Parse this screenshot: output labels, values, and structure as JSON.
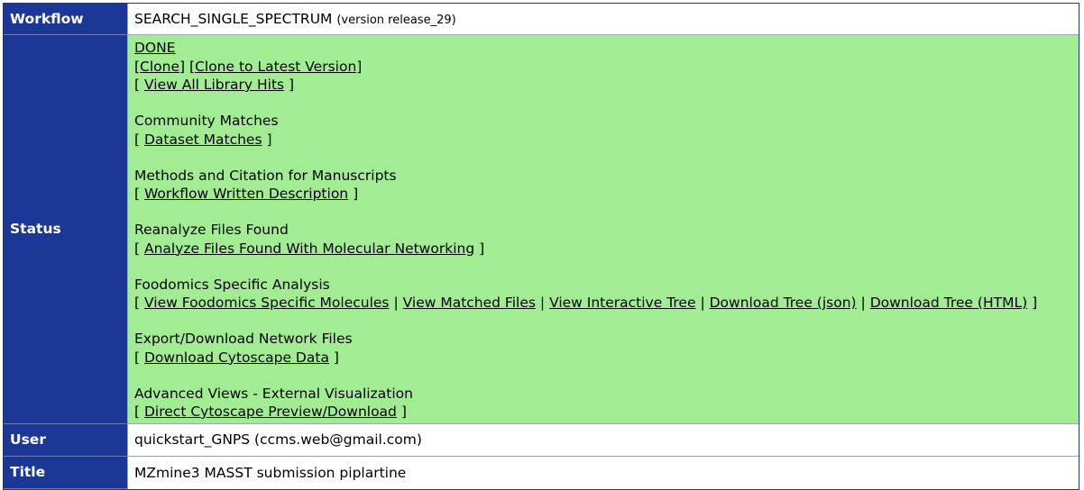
{
  "rows": {
    "workflow": {
      "label": "Workflow",
      "name": "SEARCH_SINGLE_SPECTRUM",
      "version": "(version release_29)"
    },
    "status": {
      "label": "Status",
      "state": "DONE",
      "clone": "[Clone]",
      "clone_latest": "[Clone to Latest Version]",
      "view_all_hits": "View All Library Hits",
      "sections": {
        "community": {
          "title": "Community Matches",
          "links": [
            "Dataset Matches"
          ]
        },
        "methods": {
          "title": "Methods and Citation for Manuscripts",
          "links": [
            "Workflow Written Description"
          ]
        },
        "reanalyze": {
          "title": "Reanalyze Files Found",
          "links": [
            "Analyze Files Found With Molecular Networking"
          ]
        },
        "foodomics": {
          "title": "Foodomics Specific Analysis",
          "links": [
            "View Foodomics Specific Molecules",
            "View Matched Files",
            "View Interactive Tree",
            "Download Tree (json)",
            "Download Tree (HTML)"
          ]
        },
        "export": {
          "title": "Export/Download Network Files",
          "links": [
            "Download Cytoscape Data"
          ]
        },
        "advanced": {
          "title": "Advanced Views - External Visualization",
          "links": [
            "Direct Cytoscape Preview/Download"
          ]
        }
      }
    },
    "user": {
      "label": "User",
      "value": "quickstart_GNPS (ccms.web@gmail.com)"
    },
    "title": {
      "label": "Title",
      "value": "MZmine3 MASST submission piplartine"
    }
  },
  "colors": {
    "label_bg": "#1b3896",
    "status_bg": "#a2ed94",
    "value_bg": "#ffffff"
  },
  "text_glyphs": {
    "open_bracket": "[",
    "close_bracket": "]",
    "pipe": "|"
  }
}
